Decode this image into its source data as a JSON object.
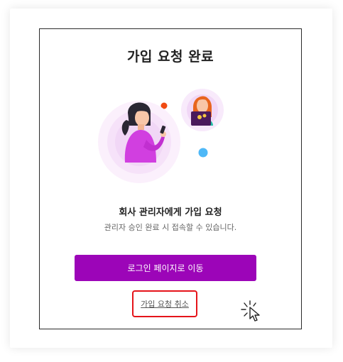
{
  "dialog": {
    "title": "가입 요청 완료",
    "heading": "회사 관리자에게 가입 요청",
    "subtext": "관리자 승인 완료 시 접속할 수 있습니다.",
    "login_button_label": "로그인 페이지로 이동",
    "cancel_link_label": "가입 요청 취소"
  },
  "colors": {
    "primary": "#9c05b8",
    "highlight": "#e5141a",
    "accent_red": "#f04a12",
    "accent_blue": "#4eb8f7"
  },
  "icons": [
    "person-with-phone-illustration",
    "person-with-laptop-illustration",
    "click-cursor-icon"
  ]
}
